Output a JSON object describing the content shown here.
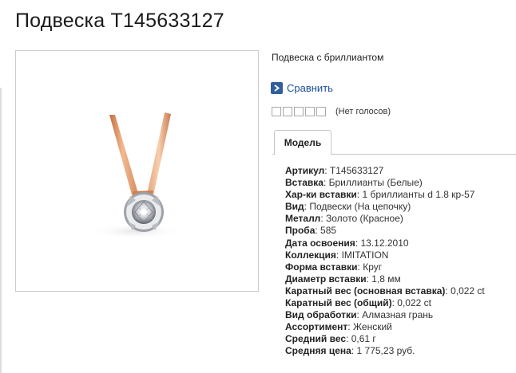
{
  "title": "Подвеска Т145633127",
  "subtitle": "Подвеска с бриллиантом",
  "compare_label": "Сравнить",
  "rating": {
    "stars_total": 5,
    "stars_filled": 0,
    "votes_text": "(Нет голосов)"
  },
  "tab_label": "Модель",
  "specs": [
    {
      "key": "Артикул",
      "value": "Т145633127"
    },
    {
      "key": "Вставка",
      "value": "Бриллианты (Белые)"
    },
    {
      "key": "Хар-ки вставки",
      "value": "1 бриллианты d 1.8 кр-57"
    },
    {
      "key": "Вид",
      "value": "Подвески (На цепочку)"
    },
    {
      "key": "Металл",
      "value": "Золото (Красное)"
    },
    {
      "key": "Проба",
      "value": "585"
    },
    {
      "key": "Дата освоения",
      "value": "13.12.2010"
    },
    {
      "key": "Коллекция",
      "value": "IMITATION"
    },
    {
      "key": "Форма вставки",
      "value": "Круг"
    },
    {
      "key": "Диаметр вставки",
      "value": "1,8 мм"
    },
    {
      "key": "Каратный вес (основная вставка)",
      "value": "0,022 ct"
    },
    {
      "key": "Каратный вес (общий)",
      "value": "0,022 ct"
    },
    {
      "key": "Вид обработки",
      "value": "Алмазная грань"
    },
    {
      "key": "Ассортимент",
      "value": "Женский"
    },
    {
      "key": "Средний вес",
      "value": "0,61 г"
    },
    {
      "key": "Средняя цена",
      "value": "1 775,23 руб."
    }
  ],
  "colors": {
    "link": "#1a4f99",
    "compare_icon_bg": "#2f5f9e",
    "gold": "#d98a5e",
    "border": "#cccccc"
  },
  "icons": {
    "compare": "chevron-right-icon"
  }
}
